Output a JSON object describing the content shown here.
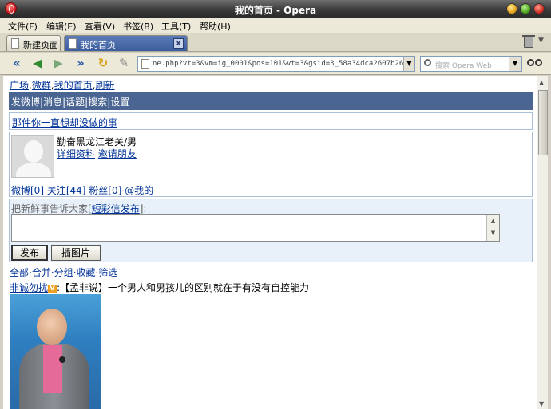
{
  "window": {
    "title": "我的首页 - Opera"
  },
  "menu": [
    "文件(F)",
    "编辑(E)",
    "查看(V)",
    "书签(B)",
    "工具(T)",
    "帮助(H)"
  ],
  "tabs": {
    "new_tab": "新建页面",
    "active_tab": "我的首页",
    "close_glyph": "x"
  },
  "toolbar": {
    "address": "ne.php?vt=3&vm=ig_0001&pos=101&vt=3&gsid=3_58a34dca2607b2690",
    "search_placeholder": "搜索 Opera Web"
  },
  "page": {
    "top_links": {
      "plaza": "广场",
      "weiqun": "微群",
      "mine": "我的首页",
      "refresh": "刷新"
    },
    "nav": {
      "post": "发微博",
      "messages": "消息",
      "topics": "话题",
      "search": "搜索",
      "settings": "设置"
    },
    "slogan": "那件你一直想却没做的事",
    "profile": {
      "username": "勤奋黑龙江老关/男",
      "details": "详细资料",
      "invite": "邀请朋友"
    },
    "stats": {
      "weibo": "微博[0]",
      "following": "关注[44]",
      "fans": "粉丝[0]",
      "at_me": "@我的"
    },
    "compose": {
      "label_prefix": "把新鲜事告诉大家[",
      "label_link": "短彩信发布",
      "label_suffix": "]:",
      "publish": "发布",
      "insert_image": "插图片"
    },
    "filters": {
      "all": "全部",
      "merge": "合并",
      "group": "分组",
      "favorites": "收藏",
      "screen": "筛选"
    },
    "feed": {
      "author": "非诚勿扰",
      "badge": "V",
      "text": ":【孟非说】一个男人和男孩儿的区别就在于有没有自控能力"
    }
  }
}
